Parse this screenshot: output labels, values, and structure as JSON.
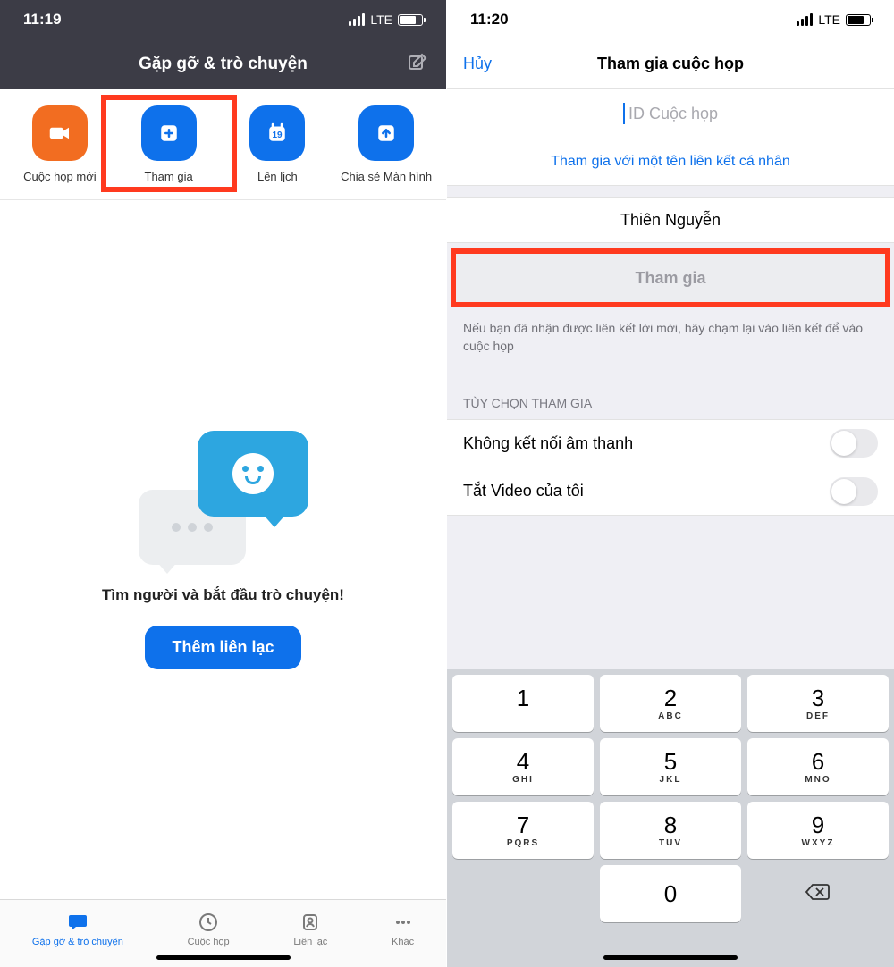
{
  "left": {
    "status": {
      "time": "11:19",
      "network": "LTE"
    },
    "header": {
      "title": "Gặp gỡ & trò chuyện"
    },
    "actions": [
      {
        "label": "Cuộc họp mới",
        "icon": "video"
      },
      {
        "label": "Tham gia",
        "icon": "plus",
        "highlighted": true
      },
      {
        "label": "Lên lịch",
        "icon": "calendar",
        "day": "19"
      },
      {
        "label": "Chia sẻ Màn hình",
        "icon": "upload"
      }
    ],
    "empty": {
      "text": "Tìm người và bắt đầu trò chuyện!",
      "button": "Thêm liên lạc"
    },
    "tabs": [
      {
        "label": "Gặp gỡ & trò chuyện",
        "icon": "chat",
        "active": true
      },
      {
        "label": "Cuộc họp",
        "icon": "clock"
      },
      {
        "label": "Liên lạc",
        "icon": "contact"
      },
      {
        "label": "Khác",
        "icon": "more"
      }
    ]
  },
  "right": {
    "status": {
      "time": "11:20",
      "network": "LTE"
    },
    "header": {
      "cancel": "Hủy",
      "title": "Tham gia cuộc họp"
    },
    "meeting_id_placeholder": "ID Cuộc họp",
    "personal_link": "Tham gia với một tên liên kết cá nhân",
    "user_name": "Thiên Nguyễn",
    "join_button": "Tham gia",
    "hint": "Nếu bạn đã nhận được liên kết lời mời, hãy chạm lại vào liên kết để vào cuộc họp",
    "section_label": "TÙY CHỌN THAM GIA",
    "options": [
      {
        "label": "Không kết nối âm thanh",
        "value": false
      },
      {
        "label": "Tắt Video của tôi",
        "value": false
      }
    ],
    "keypad": [
      {
        "d": "1",
        "l": ""
      },
      {
        "d": "2",
        "l": "ABC"
      },
      {
        "d": "3",
        "l": "DEF"
      },
      {
        "d": "4",
        "l": "GHI"
      },
      {
        "d": "5",
        "l": "JKL"
      },
      {
        "d": "6",
        "l": "MNO"
      },
      {
        "d": "7",
        "l": "PQRS"
      },
      {
        "d": "8",
        "l": "TUV"
      },
      {
        "d": "9",
        "l": "WXYZ"
      },
      {
        "d": "",
        "l": ""
      },
      {
        "d": "0",
        "l": ""
      },
      {
        "d": "del",
        "l": ""
      }
    ]
  }
}
